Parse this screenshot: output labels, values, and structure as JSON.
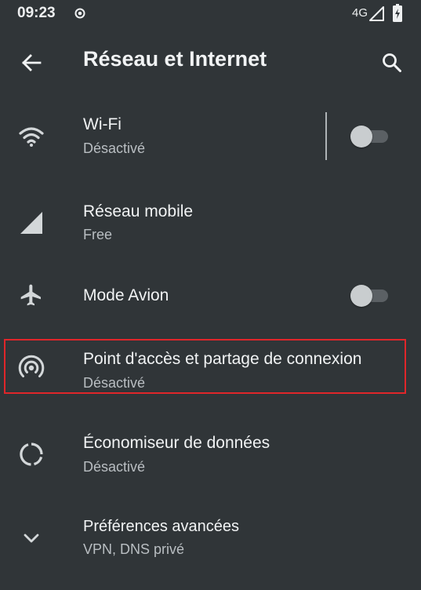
{
  "status_bar": {
    "time": "09:23",
    "network": "4G"
  },
  "header": {
    "title": "Réseau et Internet"
  },
  "settings": [
    {
      "title": "Wi-Fi",
      "subtitle": "Désactivé",
      "toggle": "off"
    },
    {
      "title": "Réseau mobile",
      "subtitle": "Free"
    },
    {
      "title": "Mode Avion",
      "toggle": "off"
    },
    {
      "title": "Point d'accès et partage de connexion",
      "subtitle": "Désactivé"
    },
    {
      "title": "Économiseur de données",
      "subtitle": "Désactivé"
    },
    {
      "title": "Préférences avancées",
      "subtitle": "VPN, DNS privé"
    }
  ],
  "colors": {
    "background": "#303538",
    "highlight": "#e0262a"
  }
}
